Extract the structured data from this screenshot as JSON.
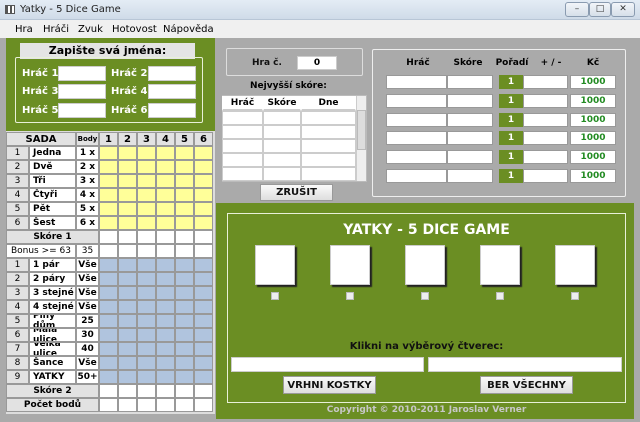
{
  "window": {
    "title": "Yatky - 5 Dice Game"
  },
  "menu": [
    "Hra",
    "Hráči",
    "Zvuk",
    "Hotovost",
    "Nápověda"
  ],
  "names": {
    "title": "Zapište svá jména:",
    "players": [
      "Hráč 1",
      "Hráč 2",
      "Hráč 3",
      "Hráč 4",
      "Hráč 5",
      "Hráč 6"
    ]
  },
  "score": {
    "header": {
      "sada": "SADA",
      "body": "Body",
      "cols": [
        "1",
        "2",
        "3",
        "4",
        "5",
        "6"
      ]
    },
    "upper": [
      {
        "n": "1",
        "name": "Jedna",
        "pts": "1 x"
      },
      {
        "n": "2",
        "name": "Dvě",
        "pts": "2 x"
      },
      {
        "n": "3",
        "name": "Tři",
        "pts": "3 x"
      },
      {
        "n": "4",
        "name": "Čtyři",
        "pts": "4 x"
      },
      {
        "n": "5",
        "name": "Pět",
        "pts": "5 x"
      },
      {
        "n": "6",
        "name": "Šest",
        "pts": "6 x"
      }
    ],
    "skore1": "Skóre 1",
    "bonus": "Bonus >= 63",
    "bonus_pts": "35",
    "lower": [
      {
        "n": "1",
        "name": "1 pár",
        "pts": "Vše"
      },
      {
        "n": "2",
        "name": "2 páry",
        "pts": "Vše"
      },
      {
        "n": "3",
        "name": "3 stejné",
        "pts": "Vše"
      },
      {
        "n": "4",
        "name": "4 stejné",
        "pts": "Vše"
      },
      {
        "n": "5",
        "name": "Plný dům",
        "pts": "25"
      },
      {
        "n": "6",
        "name": "Malá ulice",
        "pts": "30"
      },
      {
        "n": "7",
        "name": "Velká ulice",
        "pts": "40"
      },
      {
        "n": "8",
        "name": "Šance",
        "pts": "Vše"
      },
      {
        "n": "9",
        "name": "YATKY",
        "pts": "50+"
      }
    ],
    "skore2": "Skóre 2",
    "total": "Počet bodů"
  },
  "game": {
    "label": "Hra č.",
    "value": "0"
  },
  "highscore": {
    "title": "Nejvyšší skóre:",
    "cols": [
      "Hráč",
      "Skóre",
      "Dne"
    ],
    "cancel": "ZRUŠIT"
  },
  "players_table": {
    "cols": [
      "Hráč",
      "Skóre",
      "Pořadí",
      "+ / -",
      "Kč"
    ],
    "rows": [
      {
        "rank": "1",
        "money": "1000"
      },
      {
        "rank": "1",
        "money": "1000"
      },
      {
        "rank": "1",
        "money": "1000"
      },
      {
        "rank": "1",
        "money": "1000"
      },
      {
        "rank": "1",
        "money": "1000"
      },
      {
        "rank": "1",
        "money": "1000"
      }
    ]
  },
  "board": {
    "title": "YATKY - 5 DICE GAME",
    "prompt": "Klikni na výběrový čtverec:",
    "roll": "VRHNI KOSTKY",
    "take": "BER VŠECHNY",
    "copyright": "Copyright © 2010-2011 Jaroslav Verner"
  },
  "colors": {
    "green": "#6b8e23",
    "yellow": "#ffff99",
    "blue": "#b0c4de",
    "money": "#228b22"
  }
}
